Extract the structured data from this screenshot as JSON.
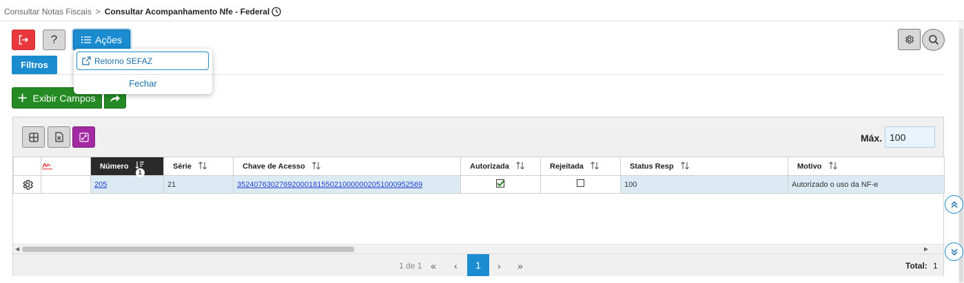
{
  "breadcrumb": {
    "parent": "Consultar Notas Fiscais",
    "separator": ">",
    "current": "Consultar Acompanhamento Nfe - Federal"
  },
  "toolbar": {
    "help_label": "?",
    "acoes_label": "Ações",
    "filtros_label": "Filtros",
    "exibir_campos_label": "Exibir Campos"
  },
  "dropdown": {
    "item_label": "Retorno SEFAZ",
    "close_label": "Fechar"
  },
  "grid": {
    "max_label": "Máx.",
    "max_value": "100",
    "columns": [
      {
        "label": ""
      },
      {
        "label": ""
      },
      {
        "label": "Número",
        "sort_badge": "1"
      },
      {
        "label": "Série"
      },
      {
        "label": "Chave de Acesso"
      },
      {
        "label": "Autorizada"
      },
      {
        "label": "Rejeitada"
      },
      {
        "label": "Status Resp"
      },
      {
        "label": "Motivo"
      }
    ],
    "rows": [
      {
        "numero": "205",
        "serie": "21",
        "chave": "35240763027692000181550210000002051000952569",
        "autorizada": true,
        "rejeitada": false,
        "status_resp": "100",
        "motivo": "Autorizado o uso da NF-e"
      }
    ]
  },
  "pager": {
    "info": "1 de 1",
    "current_page": "1",
    "total_label": "Total:",
    "total_value": "1"
  },
  "icons": {
    "exit": "exit-icon",
    "help": "help-icon",
    "list": "list-icon",
    "external": "external-link-icon",
    "gear": "gear-icon",
    "search": "search-icon",
    "plus": "plus-icon",
    "share": "share-icon",
    "grid": "grid-icon",
    "excel": "excel-icon",
    "expand": "expand-icon",
    "signature": "signature-icon",
    "clock": "clock-icon"
  },
  "colors": {
    "primary": "#1a8ccf",
    "danger": "#e8383d",
    "success": "#248a24",
    "purple": "#a32aa3",
    "row_bg": "#dcebf3"
  }
}
